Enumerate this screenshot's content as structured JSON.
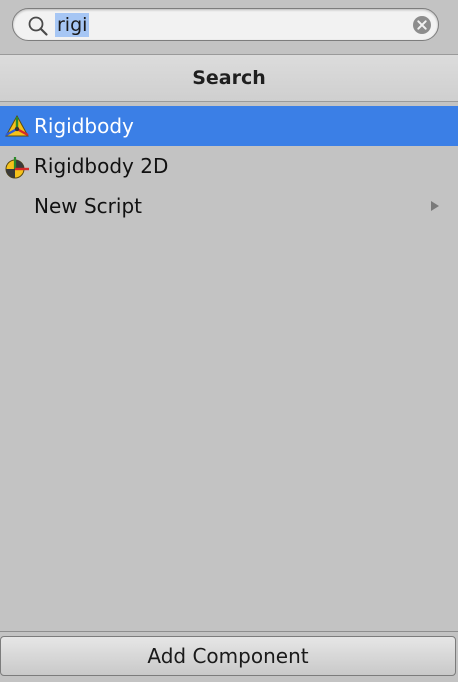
{
  "search": {
    "query": "rigi",
    "icon": "search-icon",
    "clear_icon": "clear-icon"
  },
  "header": {
    "title": "Search"
  },
  "results": [
    {
      "label": "Rigidbody",
      "icon": "rigidbody-icon",
      "selected": true
    },
    {
      "label": "Rigidbody 2D",
      "icon": "rigidbody-2d-icon",
      "selected": false
    },
    {
      "label": "New Script",
      "icon": "chevron-right-icon",
      "selected": false
    }
  ],
  "footer": {
    "button_label": "Add Component"
  },
  "colors": {
    "selection": "#3b7fe6",
    "panel_bg": "#c3c3c3",
    "search_highlight": "#a6c6f4"
  }
}
